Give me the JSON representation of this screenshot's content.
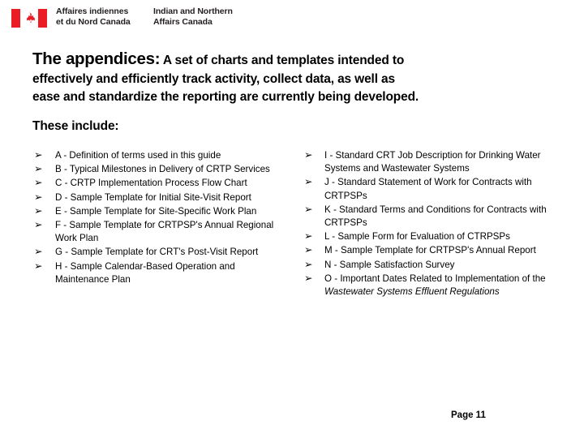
{
  "header": {
    "flag_alt": "canada-flag",
    "flag_red": "#EA1D25",
    "department_fr": "Affaires indiennes\net du Nord Canada",
    "department_en": "Indian and Northern\nAffairs Canada"
  },
  "title": {
    "lead": "The appendices:",
    "rest_line1": " A set of charts and templates intended to",
    "line2": "effectively and efficiently track activity, collect data, as well as",
    "line3": "ease and standardize the reporting are currently being developed.",
    "these_include": "These include:"
  },
  "bullet_glyph": "➢",
  "appendices": {
    "left": [
      "A - Definition of terms used in this guide",
      "B - Typical Milestones in Delivery of CRTP Services",
      "C - CRTP Implementation Process Flow Chart",
      "D - Sample Template for Initial Site-Visit Report",
      "E - Sample Template for Site-Specific Work Plan",
      "F - Sample Template for CRTPSP's Annual Regional Work Plan",
      "G - Sample Template for CRT's Post-Visit Report",
      "H - Sample Calendar-Based Operation and Maintenance Plan"
    ],
    "right": [
      {
        "text": "I - Standard CRT Job Description for Drinking Water Systems and Wastewater Systems"
      },
      {
        "text": "J - Standard Statement of Work for Contracts with CRTPSPs"
      },
      {
        "text": "K - Standard Terms and Conditions for Contracts with CRTPSPs"
      },
      {
        "text": "L - Sample Form for Evaluation of CTRPSPs"
      },
      {
        "text": "M - Sample Template for CRTPSP's Annual Report"
      },
      {
        "text": "N - Sample Satisfaction Survey"
      },
      {
        "prefix": "O - Important Dates Related to Implementation of the ",
        "italic": "Wastewater Systems Effluent Regulations",
        "suffix": ""
      }
    ]
  },
  "footer": {
    "page_label": "Page 11"
  }
}
